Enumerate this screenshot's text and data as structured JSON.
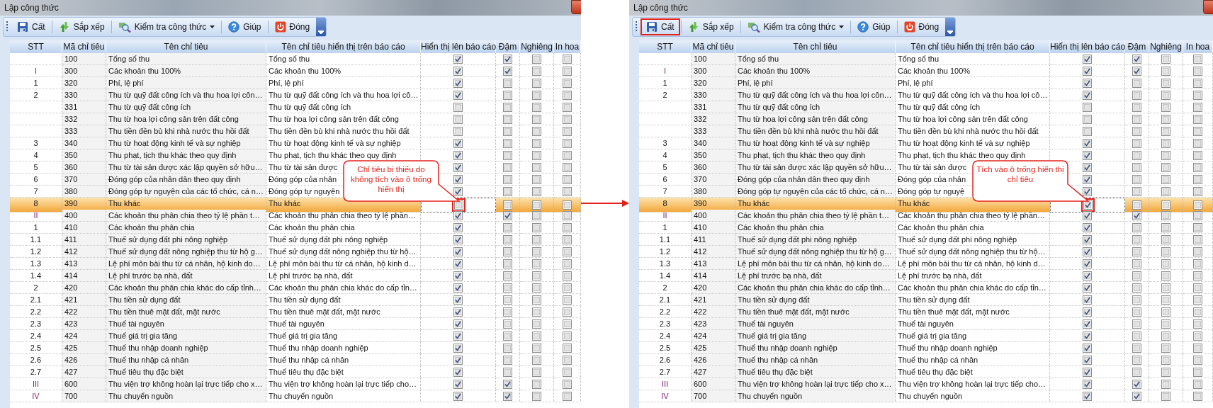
{
  "panels": [
    {
      "title": "Lập công thức",
      "toolbar": [
        {
          "kind": "save",
          "label": "Cất",
          "marked": false,
          "dropdown": false
        },
        {
          "kind": "sort",
          "label": "Sắp xếp",
          "marked": false,
          "dropdown": false
        },
        {
          "kind": "check",
          "label": "Kiểm tra công thức",
          "marked": false,
          "dropdown": true
        },
        {
          "kind": "help",
          "label": "Giúp",
          "marked": false,
          "dropdown": false
        },
        {
          "kind": "close",
          "label": "Đóng",
          "marked": false,
          "dropdown": false
        }
      ],
      "columns": [
        "STT",
        "Mã chỉ tiêu",
        "Tên chỉ tiêu",
        "Tên chỉ tiêu hiển thị trên báo cáo",
        "Hiển thị lên báo cáo",
        "Đậm",
        "Nghiêng",
        "In hoa"
      ],
      "rows": [
        {
          "kind": "item",
          "stt": "",
          "code": "100",
          "name": "Tổng số thu",
          "display_name": "Tổng số thu",
          "show": true,
          "bold": true,
          "italic": false,
          "upper": false,
          "selected": false,
          "marked": false
        },
        {
          "kind": "section",
          "stt": "I",
          "code": "300",
          "name": "Các khoản thu 100%",
          "display_name": "Các khoản thu 100%",
          "show": true,
          "bold": true,
          "italic": false,
          "upper": false,
          "selected": false,
          "marked": false
        },
        {
          "kind": "item",
          "stt": "1",
          "code": "320",
          "name": "Phí, lệ phí",
          "display_name": "Phí, lệ phí",
          "show": true,
          "bold": false,
          "italic": false,
          "upper": false,
          "selected": false,
          "marked": false
        },
        {
          "kind": "item",
          "stt": "2",
          "code": "330",
          "name": "Thu từ quỹ đất công ích và thu hoa lợi côn…",
          "display_name": "Thu từ quỹ đất công ích và thu hoa lợi cô…",
          "show": true,
          "bold": false,
          "italic": false,
          "upper": false,
          "selected": false,
          "marked": false
        },
        {
          "kind": "item",
          "stt": "",
          "code": "331",
          "name": "Thu từ quỹ đất công ích",
          "display_name": "Thu từ quỹ đất công ích",
          "show": false,
          "bold": false,
          "italic": false,
          "upper": false,
          "selected": false,
          "marked": false
        },
        {
          "kind": "item",
          "stt": "",
          "code": "332",
          "name": "Thu từ hoa lợi công sản trên đất công",
          "display_name": "Thu từ hoa lợi công sản trên đất công",
          "show": false,
          "bold": false,
          "italic": false,
          "upper": false,
          "selected": false,
          "marked": false
        },
        {
          "kind": "item",
          "stt": "",
          "code": "333",
          "name": "Thu tiền đền bù khi nhà nước thu hồi đất",
          "display_name": "Thu tiền đền bù khi nhà nước thu hồi đất",
          "show": false,
          "bold": false,
          "italic": false,
          "upper": false,
          "selected": false,
          "marked": false
        },
        {
          "kind": "item",
          "stt": "3",
          "code": "340",
          "name": "Thu từ hoạt động kinh tế và sự nghiệp",
          "display_name": "Thu từ hoạt động kinh tế và sự nghiệp",
          "show": true,
          "bold": false,
          "italic": false,
          "upper": false,
          "selected": false,
          "marked": false
        },
        {
          "kind": "item",
          "stt": "4",
          "code": "350",
          "name": "Thu phạt, tịch thu khác theo quy định",
          "display_name": "Thu phạt, tịch thu khác theo quy định",
          "show": true,
          "bold": false,
          "italic": false,
          "upper": false,
          "selected": false,
          "marked": false
        },
        {
          "kind": "item",
          "stt": "5",
          "code": "360",
          "name": "Thu từ tài sản được xác lập quyền sở hữu…",
          "display_name": "Thu từ tài sản được",
          "show": true,
          "bold": false,
          "italic": false,
          "upper": false,
          "selected": false,
          "marked": false
        },
        {
          "kind": "item",
          "stt": "6",
          "code": "370",
          "name": "Đóng góp của nhân dân theo quy định",
          "display_name": "Đóng góp của nhân",
          "show": true,
          "bold": false,
          "italic": false,
          "upper": false,
          "selected": false,
          "marked": false
        },
        {
          "kind": "item",
          "stt": "7",
          "code": "380",
          "name": "Đóng góp tự nguyện của các tổ chức, cá n…",
          "display_name": "Đóng góp tự nguyện",
          "show": true,
          "bold": false,
          "italic": false,
          "upper": false,
          "selected": false,
          "marked": false
        },
        {
          "kind": "item",
          "stt": "8",
          "code": "390",
          "name": "Thu khác",
          "display_name": "Thu khác",
          "show": false,
          "bold": false,
          "italic": false,
          "upper": false,
          "selected": true,
          "marked": true
        },
        {
          "kind": "section",
          "stt": "II",
          "code": "400",
          "name": "Các khoản thu phân chia theo tỷ lệ phần t…",
          "display_name": "Các khoản thu phân chia theo tỷ lệ phần…",
          "show": true,
          "bold": true,
          "italic": false,
          "upper": false,
          "selected": false,
          "marked": false
        },
        {
          "kind": "item",
          "stt": "1",
          "code": "410",
          "name": "Các khoản thu phân chia",
          "display_name": "Các khoản thu phân chia",
          "show": true,
          "bold": false,
          "italic": false,
          "upper": false,
          "selected": false,
          "marked": false
        },
        {
          "kind": "item",
          "stt": "1.1",
          "code": "411",
          "name": "Thuế sử dụng đất phi nông nghiệp",
          "display_name": "Thuế sử dụng đất phi nông nghiệp",
          "show": true,
          "bold": false,
          "italic": false,
          "upper": false,
          "selected": false,
          "marked": false
        },
        {
          "kind": "item",
          "stt": "1.2",
          "code": "412",
          "name": "Thuế sử dụng đất nông nghiệp thu từ hộ g…",
          "display_name": "Thuế sử dụng đất nông nghiệp thu từ hộ…",
          "show": true,
          "bold": false,
          "italic": false,
          "upper": false,
          "selected": false,
          "marked": false
        },
        {
          "kind": "item",
          "stt": "1.3",
          "code": "413",
          "name": "Lệ phí môn bài thu từ cá nhân, hộ kinh do…",
          "display_name": "Lệ phí môn bài thu từ cá nhân, hộ kinh d…",
          "show": true,
          "bold": false,
          "italic": false,
          "upper": false,
          "selected": false,
          "marked": false
        },
        {
          "kind": "item",
          "stt": "1.4",
          "code": "414",
          "name": "Lệ phí trước bạ nhà, đất",
          "display_name": "Lệ phí trước bạ nhà, đất",
          "show": true,
          "bold": false,
          "italic": false,
          "upper": false,
          "selected": false,
          "marked": false
        },
        {
          "kind": "item",
          "stt": "2",
          "code": "420",
          "name": "Các khoản thu phân chia khác do cấp tỉnh…",
          "display_name": "Các khoản thu phân chia khác do cấp tỉn…",
          "show": true,
          "bold": false,
          "italic": false,
          "upper": false,
          "selected": false,
          "marked": false
        },
        {
          "kind": "item",
          "stt": "2.1",
          "code": "421",
          "name": "Thu tiền sử dụng đất",
          "display_name": "Thu tiền sử dụng đất",
          "show": true,
          "bold": false,
          "italic": false,
          "upper": false,
          "selected": false,
          "marked": false
        },
        {
          "kind": "item",
          "stt": "2.2",
          "code": "422",
          "name": "Thu tiền thuê mặt đất, mặt nước",
          "display_name": "Thu tiền thuê mặt đất, mặt nước",
          "show": true,
          "bold": false,
          "italic": false,
          "upper": false,
          "selected": false,
          "marked": false
        },
        {
          "kind": "item",
          "stt": "2.3",
          "code": "423",
          "name": "Thuế tài nguyên",
          "display_name": "Thuế tài nguyên",
          "show": true,
          "bold": false,
          "italic": false,
          "upper": false,
          "selected": false,
          "marked": false
        },
        {
          "kind": "item",
          "stt": "2.4",
          "code": "424",
          "name": "Thuế giá trị gia tăng",
          "display_name": "Thuế giá trị gia tăng",
          "show": true,
          "bold": false,
          "italic": false,
          "upper": false,
          "selected": false,
          "marked": false
        },
        {
          "kind": "item",
          "stt": "2.5",
          "code": "425",
          "name": "Thuế thu nhập doanh nghiệp",
          "display_name": "Thuế thu nhập doanh nghiệp",
          "show": true,
          "bold": false,
          "italic": false,
          "upper": false,
          "selected": false,
          "marked": false
        },
        {
          "kind": "item",
          "stt": "2.6",
          "code": "426",
          "name": "Thuế thu nhập cá nhân",
          "display_name": "Thuế thu nhập cá nhân",
          "show": true,
          "bold": false,
          "italic": false,
          "upper": false,
          "selected": false,
          "marked": false
        },
        {
          "kind": "item",
          "stt": "2.7",
          "code": "427",
          "name": "Thuế tiêu thụ đặc biệt",
          "display_name": "Thuế tiêu thụ đặc biệt",
          "show": true,
          "bold": false,
          "italic": false,
          "upper": false,
          "selected": false,
          "marked": false
        },
        {
          "kind": "section",
          "stt": "III",
          "code": "600",
          "name": "Thu viện trợ không hoàn lại trực tiếp cho x…",
          "display_name": "Thu viện trợ không hoàn lại trực tiếp cho…",
          "show": true,
          "bold": true,
          "italic": false,
          "upper": false,
          "selected": false,
          "marked": false
        },
        {
          "kind": "section",
          "stt": "IV",
          "code": "700",
          "name": "Thu chuyển nguồn",
          "display_name": "Thu chuyển nguồn",
          "show": true,
          "bold": true,
          "italic": false,
          "upper": false,
          "selected": false,
          "marked": false
        }
      ],
      "callout": "Chỉ tiêu bị thiếu do không tích vào ô trống hiển thị"
    },
    {
      "title": "Lập công thức",
      "toolbar": [
        {
          "kind": "save",
          "label": "Cất",
          "marked": true,
          "dropdown": false
        },
        {
          "kind": "sort",
          "label": "Sắp xếp",
          "marked": false,
          "dropdown": false
        },
        {
          "kind": "check",
          "label": "Kiểm tra công thức",
          "marked": false,
          "dropdown": true
        },
        {
          "kind": "help",
          "label": "Giúp",
          "marked": false,
          "dropdown": false
        },
        {
          "kind": "close",
          "label": "Đóng",
          "marked": false,
          "dropdown": false
        }
      ],
      "columns": [
        "STT",
        "Mã chỉ tiêu",
        "Tên chỉ tiêu",
        "Tên chỉ tiêu hiển thị trên báo cáo",
        "Hiển thị lên báo cáo",
        "Đậm",
        "Nghiêng",
        "In hoa"
      ],
      "rows": [
        {
          "kind": "item",
          "stt": "",
          "code": "100",
          "name": "Tổng số thu",
          "display_name": "Tổng số thu",
          "show": true,
          "bold": true,
          "italic": false,
          "upper": false,
          "selected": false,
          "marked": false
        },
        {
          "kind": "section",
          "stt": "I",
          "code": "300",
          "name": "Các khoản thu 100%",
          "display_name": "Các khoản thu 100%",
          "show": true,
          "bold": true,
          "italic": false,
          "upper": false,
          "selected": false,
          "marked": false
        },
        {
          "kind": "item",
          "stt": "1",
          "code": "320",
          "name": "Phí, lệ phí",
          "display_name": "Phí, lệ phí",
          "show": true,
          "bold": false,
          "italic": false,
          "upper": false,
          "selected": false,
          "marked": false
        },
        {
          "kind": "item",
          "stt": "2",
          "code": "330",
          "name": "Thu từ quỹ đất công ích và thu hoa lợi côn…",
          "display_name": "Thu từ quỹ đất công ích và thu hoa lợi cô…",
          "show": true,
          "bold": false,
          "italic": false,
          "upper": false,
          "selected": false,
          "marked": false
        },
        {
          "kind": "item",
          "stt": "",
          "code": "331",
          "name": "Thu từ quỹ đất công ích",
          "display_name": "Thu từ quỹ đất công ích",
          "show": false,
          "bold": false,
          "italic": false,
          "upper": false,
          "selected": false,
          "marked": false
        },
        {
          "kind": "item",
          "stt": "",
          "code": "332",
          "name": "Thu từ hoa lợi công sản trên đất công",
          "display_name": "Thu từ hoa lợi công sản trên đất công",
          "show": false,
          "bold": false,
          "italic": false,
          "upper": false,
          "selected": false,
          "marked": false
        },
        {
          "kind": "item",
          "stt": "",
          "code": "333",
          "name": "Thu tiền đền bù khi nhà nước thu hồi đất",
          "display_name": "Thu tiền đền bù khi nhà nước thu hồi đất",
          "show": false,
          "bold": false,
          "italic": false,
          "upper": false,
          "selected": false,
          "marked": false
        },
        {
          "kind": "item",
          "stt": "3",
          "code": "340",
          "name": "Thu từ hoạt động kinh tế và sự nghiệp",
          "display_name": "Thu từ hoạt động kinh tế và sự nghiệp",
          "show": true,
          "bold": false,
          "italic": false,
          "upper": false,
          "selected": false,
          "marked": false
        },
        {
          "kind": "item",
          "stt": "4",
          "code": "350",
          "name": "Thu phạt, tịch thu khác theo quy định",
          "display_name": "Thu phạt, tịch thu khác theo quy định",
          "show": true,
          "bold": false,
          "italic": false,
          "upper": false,
          "selected": false,
          "marked": false
        },
        {
          "kind": "item",
          "stt": "5",
          "code": "360",
          "name": "Thu từ tài sản được xác lập quyền sở hữu…",
          "display_name": "Thu từ tài sản được",
          "show": true,
          "bold": false,
          "italic": false,
          "upper": false,
          "selected": false,
          "marked": false
        },
        {
          "kind": "item",
          "stt": "6",
          "code": "370",
          "name": "Đóng góp của nhân dân theo quy định",
          "display_name": "Đóng góp của nhân",
          "show": true,
          "bold": false,
          "italic": false,
          "upper": false,
          "selected": false,
          "marked": false
        },
        {
          "kind": "item",
          "stt": "7",
          "code": "380",
          "name": "Đóng góp tự nguyện của các tổ chức, cá n…",
          "display_name": "Đóng góp tự nguyệ",
          "show": true,
          "bold": false,
          "italic": false,
          "upper": false,
          "selected": false,
          "marked": false
        },
        {
          "kind": "item",
          "stt": "8",
          "code": "390",
          "name": "Thu khác",
          "display_name": "Thu khác",
          "show": true,
          "bold": false,
          "italic": false,
          "upper": false,
          "selected": true,
          "marked": true
        },
        {
          "kind": "section",
          "stt": "II",
          "code": "400",
          "name": "Các khoản thu phân chia theo tỷ lệ phần t…",
          "display_name": "Các khoản thu phân chia theo tỷ lệ phần…",
          "show": true,
          "bold": true,
          "italic": false,
          "upper": false,
          "selected": false,
          "marked": false
        },
        {
          "kind": "item",
          "stt": "1",
          "code": "410",
          "name": "Các khoản thu phân chia",
          "display_name": "Các khoản thu phân chia",
          "show": true,
          "bold": false,
          "italic": false,
          "upper": false,
          "selected": false,
          "marked": false
        },
        {
          "kind": "item",
          "stt": "1.1",
          "code": "411",
          "name": "Thuế sử dụng đất phi nông nghiệp",
          "display_name": "Thuế sử dụng đất phi nông nghiệp",
          "show": true,
          "bold": false,
          "italic": false,
          "upper": false,
          "selected": false,
          "marked": false
        },
        {
          "kind": "item",
          "stt": "1.2",
          "code": "412",
          "name": "Thuế sử dụng đất nông nghiệp thu từ hộ g…",
          "display_name": "Thuế sử dụng đất nông nghiệp thu từ hộ…",
          "show": true,
          "bold": false,
          "italic": false,
          "upper": false,
          "selected": false,
          "marked": false
        },
        {
          "kind": "item",
          "stt": "1.3",
          "code": "413",
          "name": "Lệ phí môn bài thu từ cá nhân, hộ kinh do…",
          "display_name": "Lệ phí môn bài thu từ cá nhân, hộ kinh d…",
          "show": true,
          "bold": false,
          "italic": false,
          "upper": false,
          "selected": false,
          "marked": false
        },
        {
          "kind": "item",
          "stt": "1.4",
          "code": "414",
          "name": "Lệ phí trước bạ nhà, đất",
          "display_name": "Lệ phí trước bạ nhà, đất",
          "show": true,
          "bold": false,
          "italic": false,
          "upper": false,
          "selected": false,
          "marked": false
        },
        {
          "kind": "item",
          "stt": "2",
          "code": "420",
          "name": "Các khoản thu phân chia khác do cấp tỉnh…",
          "display_name": "Các khoản thu phân chia khác do cấp tỉn…",
          "show": true,
          "bold": false,
          "italic": false,
          "upper": false,
          "selected": false,
          "marked": false
        },
        {
          "kind": "item",
          "stt": "2.1",
          "code": "421",
          "name": "Thu tiền sử dụng đất",
          "display_name": "Thu tiền sử dụng đất",
          "show": true,
          "bold": false,
          "italic": false,
          "upper": false,
          "selected": false,
          "marked": false
        },
        {
          "kind": "item",
          "stt": "2.2",
          "code": "422",
          "name": "Thu tiền thuê mặt đất, mặt nước",
          "display_name": "Thu tiền thuê mặt đất, mặt nước",
          "show": true,
          "bold": false,
          "italic": false,
          "upper": false,
          "selected": false,
          "marked": false
        },
        {
          "kind": "item",
          "stt": "2.3",
          "code": "423",
          "name": "Thuế tài nguyên",
          "display_name": "Thuế tài nguyên",
          "show": true,
          "bold": false,
          "italic": false,
          "upper": false,
          "selected": false,
          "marked": false
        },
        {
          "kind": "item",
          "stt": "2.4",
          "code": "424",
          "name": "Thuế giá trị gia tăng",
          "display_name": "Thuế giá trị gia tăng",
          "show": true,
          "bold": false,
          "italic": false,
          "upper": false,
          "selected": false,
          "marked": false
        },
        {
          "kind": "item",
          "stt": "2.5",
          "code": "425",
          "name": "Thuế thu nhập doanh nghiệp",
          "display_name": "Thuế thu nhập doanh nghiệp",
          "show": true,
          "bold": false,
          "italic": false,
          "upper": false,
          "selected": false,
          "marked": false
        },
        {
          "kind": "item",
          "stt": "2.6",
          "code": "426",
          "name": "Thuế thu nhập cá nhân",
          "display_name": "Thuế thu nhập cá nhân",
          "show": true,
          "bold": false,
          "italic": false,
          "upper": false,
          "selected": false,
          "marked": false
        },
        {
          "kind": "item",
          "stt": "2.7",
          "code": "427",
          "name": "Thuế tiêu thụ đặc biệt",
          "display_name": "Thuế tiêu thụ đặc biệt",
          "show": true,
          "bold": false,
          "italic": false,
          "upper": false,
          "selected": false,
          "marked": false
        },
        {
          "kind": "section",
          "stt": "III",
          "code": "600",
          "name": "Thu viện trợ không hoàn lại trực tiếp cho x…",
          "display_name": "Thu viện trợ không hoàn lại trực tiếp cho…",
          "show": true,
          "bold": true,
          "italic": false,
          "upper": false,
          "selected": false,
          "marked": false
        },
        {
          "kind": "section",
          "stt": "IV",
          "code": "700",
          "name": "Thu chuyển nguồn",
          "display_name": "Thu chuyển nguồn",
          "show": true,
          "bold": true,
          "italic": false,
          "upper": false,
          "selected": false,
          "marked": false
        }
      ],
      "callout": "Tích vào ô trống hiển thị chỉ tiêu"
    }
  ]
}
